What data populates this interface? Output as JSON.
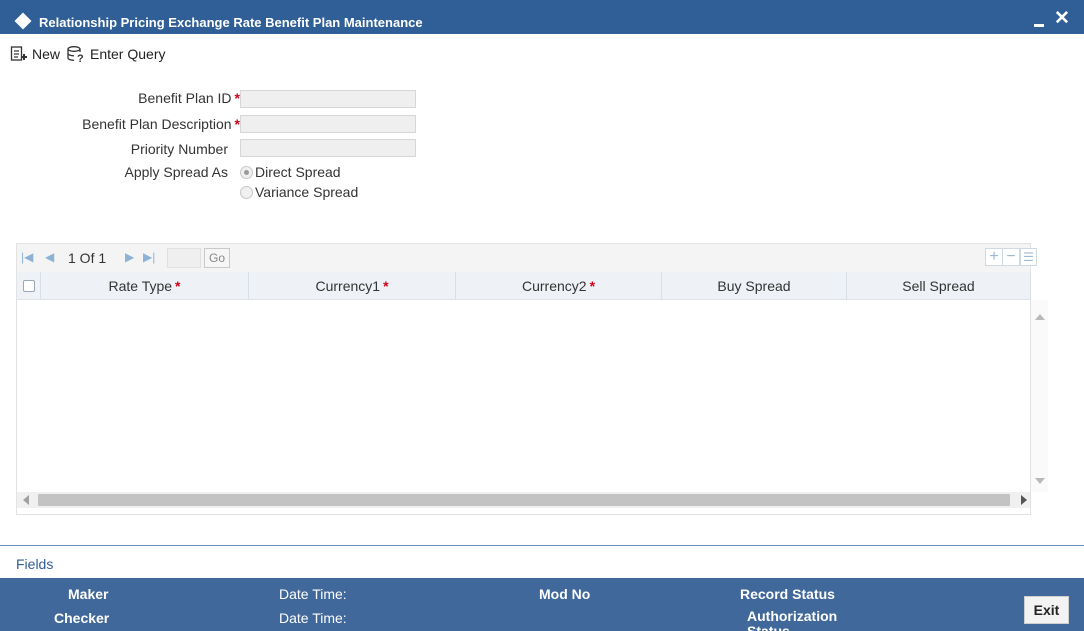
{
  "window": {
    "title": "Relationship Pricing Exchange Rate Benefit Plan Maintenance",
    "minimize_icon": "minimize-icon",
    "close_glyph": "✕"
  },
  "toolbar": {
    "new_label": "New",
    "enter_query_label": "Enter Query"
  },
  "form": {
    "benefit_plan_id_label": "Benefit Plan ID",
    "benefit_plan_id_value": "",
    "benefit_plan_description_label": "Benefit Plan Description",
    "benefit_plan_description_value": "",
    "priority_number_label": "Priority Number",
    "priority_number_value": "",
    "apply_spread_as_label": "Apply Spread As",
    "spread_options": [
      "Direct Spread",
      "Variance Spread"
    ],
    "spread_selected": "Direct Spread",
    "required_marker": "*"
  },
  "grid": {
    "pager_text": "1 Of 1",
    "go_label": "Go",
    "columns": [
      "Rate Type",
      "Currency1",
      "Currency2",
      "Buy Spread",
      "Sell Spread"
    ],
    "required_columns": [
      true,
      true,
      true,
      false,
      false
    ],
    "rows": []
  },
  "fields_link": "Fields",
  "footer": {
    "maker_label": "Maker",
    "checker_label": "Checker",
    "date_time_label": "Date Time:",
    "mod_no_label": "Mod No",
    "record_status_label": "Record Status",
    "authorization_status_label": "Authorization Status",
    "exit_label": "Exit"
  },
  "colors": {
    "titlebar": "#2f5f96",
    "footer": "#41689a",
    "required": "#d0021b"
  }
}
